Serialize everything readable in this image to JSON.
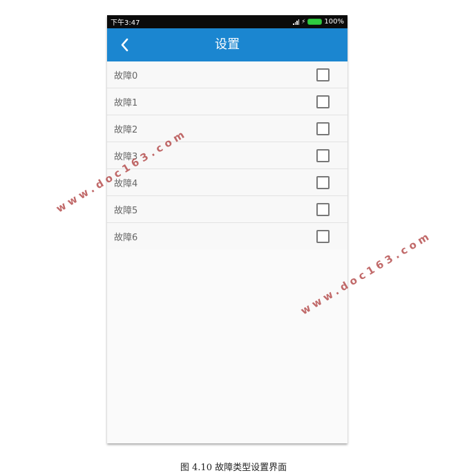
{
  "status_bar": {
    "time": "下午3:47",
    "battery": "100%"
  },
  "app_bar": {
    "title": "设置"
  },
  "items": [
    {
      "label": "故障0",
      "checked": false
    },
    {
      "label": "故障1",
      "checked": false
    },
    {
      "label": "故障2",
      "checked": false
    },
    {
      "label": "故障3",
      "checked": false
    },
    {
      "label": "故障4",
      "checked": false
    },
    {
      "label": "故障5",
      "checked": false
    },
    {
      "label": "故障6",
      "checked": false
    }
  ],
  "caption": "图 4.10  故障类型设置界面",
  "watermark": "www.doc163.com",
  "colors": {
    "app_bar": "#1b86d0",
    "status_bar": "#0b0b0b",
    "watermark": "#b24545"
  }
}
